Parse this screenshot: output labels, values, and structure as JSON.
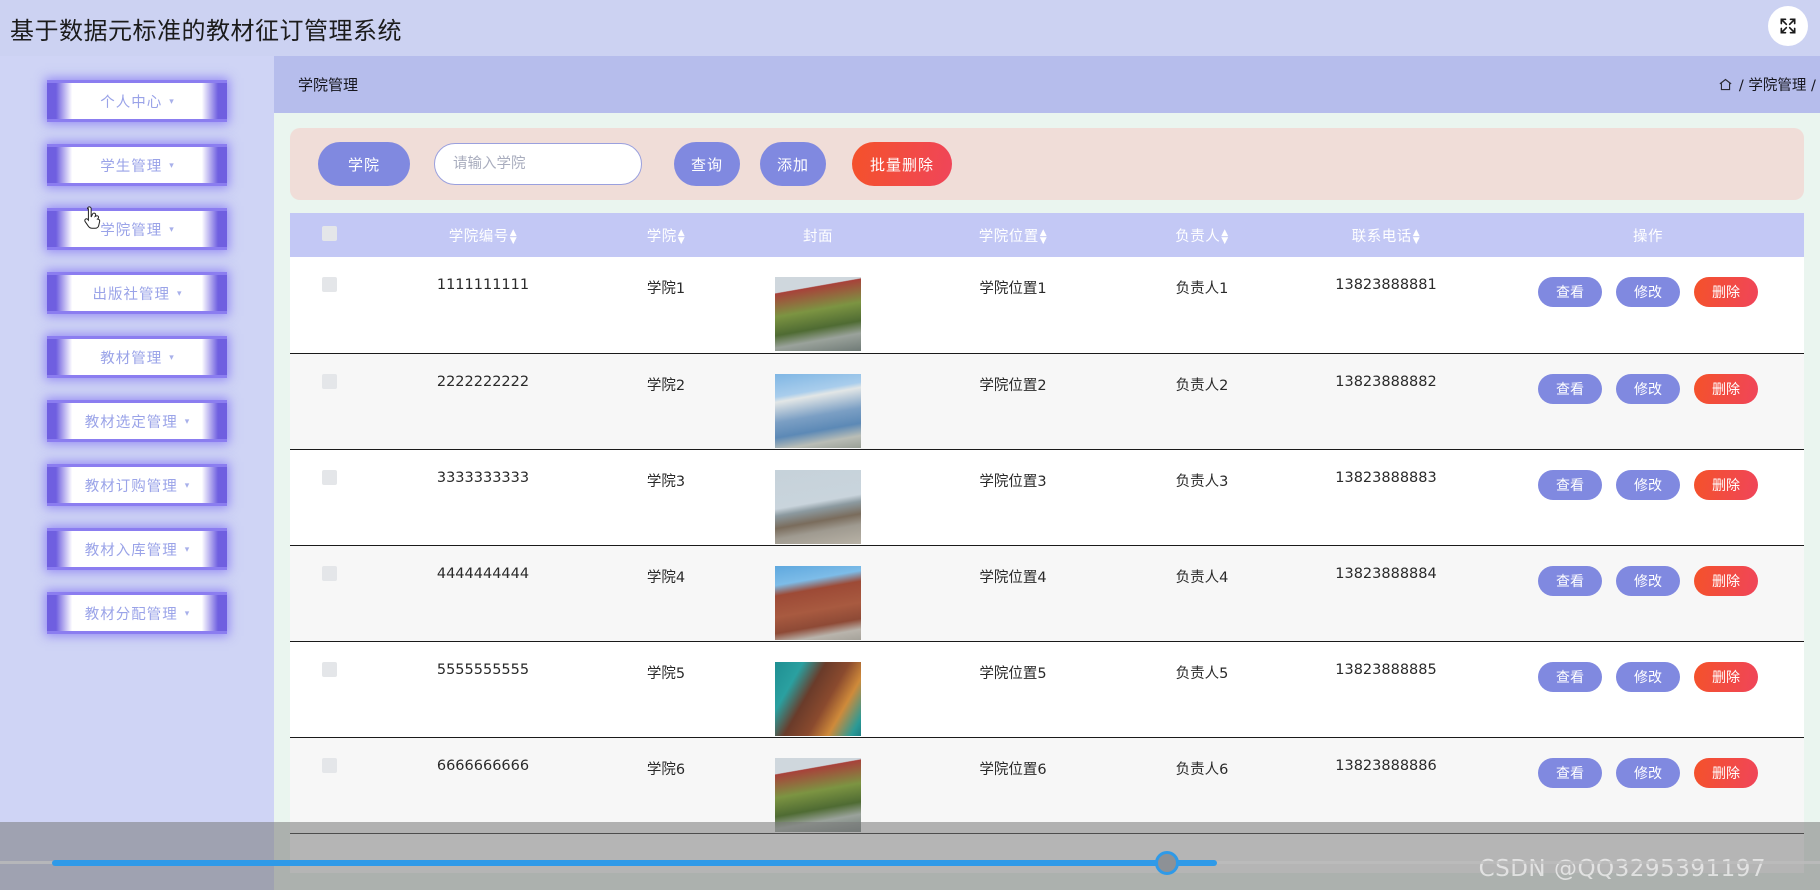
{
  "app": {
    "title": "基于数据元标准的教材征订管理系统",
    "fullscreen_icon": "fullscreen-expand-icon"
  },
  "sidebar": {
    "items": [
      {
        "label": "个人中心",
        "caret": "▾"
      },
      {
        "label": "学生管理",
        "caret": "▾"
      },
      {
        "label": "学院管理",
        "caret": "▾"
      },
      {
        "label": "出版社管理",
        "caret": "▾"
      },
      {
        "label": "教材管理",
        "caret": "▾"
      },
      {
        "label": "教材选定管理",
        "caret": "▾"
      },
      {
        "label": "教材订购管理",
        "caret": "▾"
      },
      {
        "label": "教材入库管理",
        "caret": "▾"
      },
      {
        "label": "教材分配管理",
        "caret": "▾"
      }
    ]
  },
  "header": {
    "page_title": "学院管理",
    "breadcrumb": "/ 学院管理 / 学院列",
    "home_icon": "home-icon"
  },
  "toolbar": {
    "field_label": "学院",
    "search_placeholder": "请输入学院",
    "search_value": "",
    "query_label": "查询",
    "add_label": "添加",
    "batch_delete_label": "批量删除"
  },
  "table": {
    "select_all": "",
    "columns": [
      {
        "label": "学院编号",
        "sortable": true
      },
      {
        "label": "学院",
        "sortable": true
      },
      {
        "label": "封面",
        "sortable": false
      },
      {
        "label": "学院位置",
        "sortable": true
      },
      {
        "label": "负责人",
        "sortable": true
      },
      {
        "label": "联系电话",
        "sortable": true
      },
      {
        "label": "操作",
        "sortable": false
      }
    ],
    "sort_asc": "▲",
    "sort_desc": "▼",
    "actions": {
      "view": "查看",
      "edit": "修改",
      "delete": "删除"
    },
    "rows": [
      {
        "code": "1111111111",
        "college": "学院1",
        "cover": "college-photo-1",
        "location": "学院位置1",
        "manager": "负责人1",
        "phone": "13823888881"
      },
      {
        "code": "2222222222",
        "college": "学院2",
        "cover": "college-photo-2",
        "location": "学院位置2",
        "manager": "负责人2",
        "phone": "13823888882"
      },
      {
        "code": "3333333333",
        "college": "学院3",
        "cover": "college-photo-3",
        "location": "学院位置3",
        "manager": "负责人3",
        "phone": "13823888883"
      },
      {
        "code": "4444444444",
        "college": "学院4",
        "cover": "college-photo-4",
        "location": "学院位置4",
        "manager": "负责人4",
        "phone": "13823888884"
      },
      {
        "code": "5555555555",
        "college": "学院5",
        "cover": "college-photo-5",
        "location": "学院位置5",
        "manager": "负责人5",
        "phone": "13823888885"
      },
      {
        "code": "6666666666",
        "college": "学院6",
        "cover": "college-photo-6",
        "location": "学院位置6",
        "manager": "负责人6",
        "phone": "13823888886"
      }
    ]
  },
  "watermark": {
    "text": "CSDN @QQ3295391197"
  },
  "colors": {
    "accent_purple": "#8089e0",
    "header_lavender": "#c3c8f5",
    "titlebar": "#ccd2f2",
    "crumb_bar": "#b6bdec",
    "toolbar_bg": "#f0ddd8",
    "danger_red": "#f4522a",
    "content_bg": "#eaf5ef",
    "scrollbar_blue": "#2f9ae8"
  }
}
